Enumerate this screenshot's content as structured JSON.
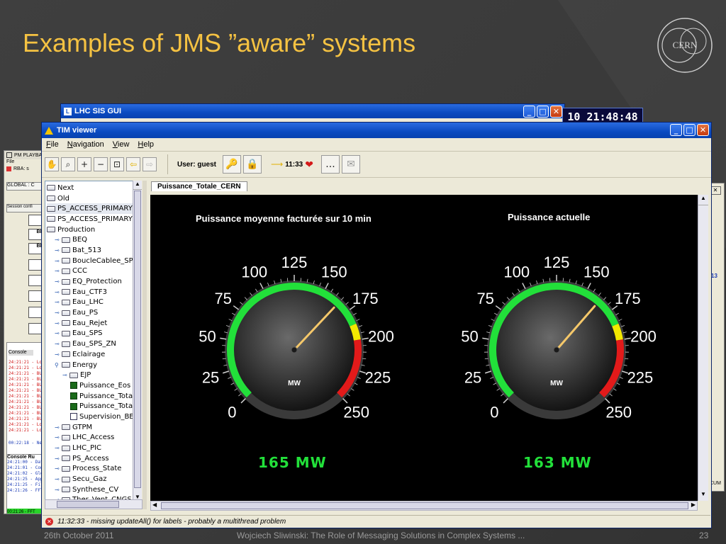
{
  "slide": {
    "title": "Examples of JMS ”aware” systems",
    "logo_text": "CERN",
    "footer_left": "26th October 2011",
    "footer_center": "Wojciech Sliwinski: The Role of Messaging Solutions in Complex Systems ...",
    "page_number": "23"
  },
  "back_windows": {
    "lhc_sis": {
      "title": "LHC SIS GUI",
      "clock": "10 21:48:48"
    },
    "pm_playback": {
      "title": "PM PLAYBAC",
      "menu": "File",
      "rba_label": "RBA: s",
      "global_label": "GLOBAL : C",
      "session_label": "Session confi",
      "bi_labels": [
        "BI/",
        "BI/"
      ],
      "console_tab": "Console",
      "console_tab2": "Console",
      "console_tab3": "Ru",
      "log_red": [
        "24:21:21 - Loa",
        "24:21:21 - Loa",
        "24:21:21 - BU",
        "24:21:21 - BU",
        "24:21:21 - BU",
        "24:21:21 - BU",
        "24:21:21 - BU",
        "24:21:21 - BU",
        "24:21:21 - BU",
        "24:21:21 - BU",
        "24:21:21 - BU",
        "24:21:21 - Loa",
        "24:21:21 - Loa"
      ],
      "log_blue_line": "00:22:18 - New e",
      "log_bottom": [
        "24:21:00 - Dat",
        "24:21:01 - Con",
        "24:21:02 - Glob",
        "24:21:25 - App",
        "24:21:25 - Filte",
        "24:21:26 - FFT"
      ],
      "status_green": "00:21:26 - FFT"
    },
    "right_fragment": {
      "value": "13",
      "bottom": "CUM"
    }
  },
  "tim_viewer": {
    "title": "TIM viewer",
    "menu": [
      "File",
      "Navigation",
      "View",
      "Help"
    ],
    "toolbar": {
      "user_label": "User: guest",
      "time": "11:33",
      "more_label": "..."
    },
    "tree": [
      {
        "label": "Next",
        "level": 0,
        "kind": "folder"
      },
      {
        "label": "Old",
        "level": 0,
        "kind": "folder"
      },
      {
        "label": "PS_ACCESS_PRIMARY",
        "level": 0,
        "kind": "folder",
        "selected": true
      },
      {
        "label": "PS_ACCESS_PRIMARY",
        "level": 0,
        "kind": "folder"
      },
      {
        "label": "Production",
        "level": 0,
        "kind": "folder"
      },
      {
        "label": "BEQ",
        "level": 1,
        "kind": "folder"
      },
      {
        "label": "Bat_513",
        "level": 1,
        "kind": "folder"
      },
      {
        "label": "BoucleCablee_SPS",
        "level": 1,
        "kind": "folder"
      },
      {
        "label": "CCC",
        "level": 1,
        "kind": "folder"
      },
      {
        "label": "EQ_Protection",
        "level": 1,
        "kind": "folder"
      },
      {
        "label": "Eau_CTF3",
        "level": 1,
        "kind": "folder"
      },
      {
        "label": "Eau_LHC",
        "level": 1,
        "kind": "folder"
      },
      {
        "label": "Eau_PS",
        "level": 1,
        "kind": "folder"
      },
      {
        "label": "Eau_Rejet",
        "level": 1,
        "kind": "folder"
      },
      {
        "label": "Eau_SPS",
        "level": 1,
        "kind": "folder"
      },
      {
        "label": "Eau_SPS_ZN",
        "level": 1,
        "kind": "folder"
      },
      {
        "label": "Eclairage",
        "level": 1,
        "kind": "folder"
      },
      {
        "label": "Energy",
        "level": 1,
        "kind": "folder",
        "open": true
      },
      {
        "label": "EJP",
        "level": 2,
        "kind": "folder"
      },
      {
        "label": "Puissance_Eos",
        "level": 3,
        "kind": "leaf"
      },
      {
        "label": "Puissance_Tota",
        "level": 3,
        "kind": "leaf"
      },
      {
        "label": "Puissance_Tota",
        "level": 3,
        "kind": "leaf"
      },
      {
        "label": "Supervision_BE",
        "level": 3,
        "kind": "chart"
      },
      {
        "label": "GTPM",
        "level": 1,
        "kind": "folder"
      },
      {
        "label": "LHC_Access",
        "level": 1,
        "kind": "folder"
      },
      {
        "label": "LHC_PIC",
        "level": 1,
        "kind": "folder"
      },
      {
        "label": "PS_Access",
        "level": 1,
        "kind": "folder"
      },
      {
        "label": "Process_State",
        "level": 1,
        "kind": "folder"
      },
      {
        "label": "Secu_Gaz",
        "level": 1,
        "kind": "folder"
      },
      {
        "label": "Synthese_CV",
        "level": 1,
        "kind": "folder"
      },
      {
        "label": "Ther_Vent_CNGS",
        "level": 1,
        "kind": "folder"
      }
    ],
    "tab_label": "Puissance_Totale_CERN",
    "gauges": [
      {
        "title": "Puissance moyenne facturée sur 10 min",
        "value": 165,
        "display": "165 MW",
        "unit": "MW"
      },
      {
        "title": "Puissance actuelle",
        "value": 163,
        "display": "163 MW",
        "unit": "MW"
      }
    ],
    "gauge_scale": {
      "min": 0,
      "max": 250,
      "labels": [
        "0",
        "25",
        "50",
        "75",
        "100",
        "125",
        "150",
        "175",
        "200",
        "225",
        "250"
      ],
      "green_to": 187,
      "yellow_to": 200,
      "red_to": 250
    },
    "colors": {
      "green": "#22e03a",
      "yellow": "#f2e800",
      "red": "#e21a1a",
      "needle": "#f5c86a"
    },
    "status_message": "11:32:33 - missing updateAll() for labels - probably a multithread problem"
  }
}
